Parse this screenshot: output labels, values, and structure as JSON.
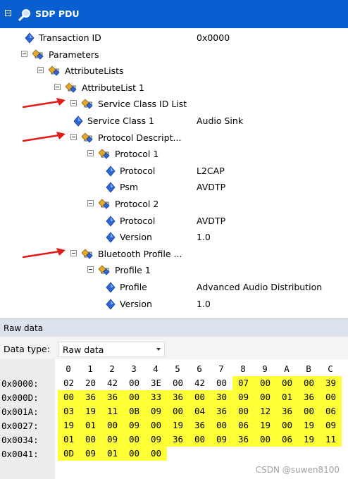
{
  "tree": {
    "root": {
      "label": "SDP PDU"
    },
    "rows": [
      {
        "label": "Transaction ID",
        "value": "0x0000",
        "icon": "diamond-icon",
        "level": 2,
        "expandable": false
      },
      {
        "label": "Parameters",
        "value": "",
        "icon": "node-icon",
        "level": 1,
        "expandable": true
      },
      {
        "label": "AttributeLists",
        "value": "",
        "icon": "node-icon",
        "level": 2,
        "expandable": true
      },
      {
        "label": "AttributeList 1",
        "value": "",
        "icon": "node-icon",
        "level": 3,
        "expandable": true
      },
      {
        "label": "Service Class ID List",
        "value": "",
        "icon": "node-icon",
        "level": 4,
        "expandable": true,
        "arrow": true
      },
      {
        "label": "Service Class 1",
        "value": "Audio Sink",
        "icon": "diamond-icon",
        "level": 5,
        "expandable": false
      },
      {
        "label": "Protocol Descript...",
        "value": "",
        "icon": "node-icon",
        "level": 4,
        "expandable": true,
        "arrow": true
      },
      {
        "label": "Protocol 1",
        "value": "",
        "icon": "node-icon",
        "level": 5,
        "expandable": true
      },
      {
        "label": "Protocol",
        "value": "L2CAP",
        "icon": "diamond-icon",
        "level": 6,
        "expandable": false
      },
      {
        "label": "Psm",
        "value": "AVDTP",
        "icon": "diamond-icon",
        "level": 6,
        "expandable": false
      },
      {
        "label": "Protocol 2",
        "value": "",
        "icon": "node-icon",
        "level": 5,
        "expandable": true
      },
      {
        "label": "Protocol",
        "value": "AVDTP",
        "icon": "diamond-icon",
        "level": 6,
        "expandable": false
      },
      {
        "label": "Version",
        "value": "1.0",
        "icon": "diamond-icon",
        "level": 6,
        "expandable": false
      },
      {
        "label": "Bluetooth Profile ...",
        "value": "",
        "icon": "node-icon",
        "level": 4,
        "expandable": true,
        "arrow": true
      },
      {
        "label": "Profile 1",
        "value": "",
        "icon": "node-icon",
        "level": 5,
        "expandable": true
      },
      {
        "label": "Profile",
        "value": "Advanced Audio Distribution",
        "icon": "diamond-icon",
        "level": 6,
        "expandable": false
      },
      {
        "label": "Version",
        "value": "1.0",
        "icon": "diamond-icon",
        "level": 6,
        "expandable": false
      }
    ]
  },
  "raw_pane": {
    "title": "Raw data",
    "data_type_label": "Data type:",
    "data_type_value": "Raw data",
    "columns": [
      "0",
      "1",
      "2",
      "3",
      "4",
      "5",
      "6",
      "7",
      "8",
      "9",
      "A",
      "B",
      "C"
    ],
    "rows": [
      {
        "addr": "0x0000:",
        "bytes": [
          "02",
          "20",
          "42",
          "00",
          "3E",
          "00",
          "42",
          "00",
          "07",
          "00",
          "00",
          "00",
          "39"
        ],
        "hl_from": 8
      },
      {
        "addr": "0x000D:",
        "bytes": [
          "00",
          "36",
          "36",
          "00",
          "33",
          "36",
          "00",
          "30",
          "09",
          "00",
          "01",
          "36",
          "00"
        ],
        "hl_from": 0
      },
      {
        "addr": "0x001A:",
        "bytes": [
          "03",
          "19",
          "11",
          "0B",
          "09",
          "00",
          "04",
          "36",
          "00",
          "12",
          "36",
          "00",
          "06"
        ],
        "hl_from": 0
      },
      {
        "addr": "0x0027:",
        "bytes": [
          "19",
          "01",
          "00",
          "09",
          "00",
          "19",
          "36",
          "00",
          "06",
          "19",
          "00",
          "19",
          "09"
        ],
        "hl_from": 0
      },
      {
        "addr": "0x0034:",
        "bytes": [
          "01",
          "00",
          "09",
          "00",
          "09",
          "36",
          "00",
          "09",
          "36",
          "00",
          "06",
          "19",
          "11"
        ],
        "hl_from": 0
      },
      {
        "addr": "0x0041:",
        "bytes": [
          "0D",
          "09",
          "01",
          "00",
          "00"
        ],
        "hl_from": 0
      }
    ]
  },
  "watermark": "CSDN @suwen8100",
  "colors": {
    "header": "#0a5fd0",
    "highlight": "#ffff38",
    "arrow": "#e11a1a",
    "diamond": "#2a66d9",
    "node": "#e3a92a"
  }
}
